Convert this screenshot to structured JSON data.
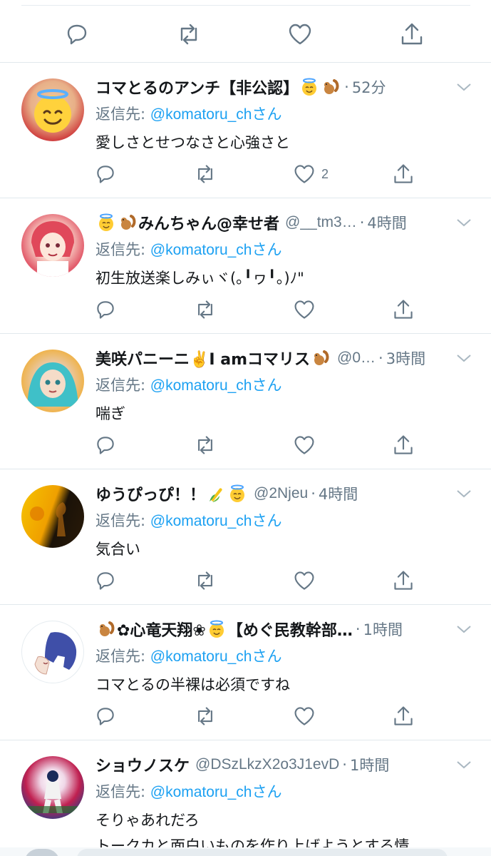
{
  "icons": {
    "reply": "reply-icon",
    "retweet": "retweet-icon",
    "like": "heart-icon",
    "share": "share-icon",
    "caret": "chevron-down-icon"
  },
  "colors": {
    "link": "#1da1f2",
    "muted": "#657786",
    "text": "#14171a",
    "divider": "#e1e8ed"
  },
  "tweets": [
    {
      "name_pre": "",
      "name_main": "コマとるのアンチ【非公認】",
      "name_emojis": [
        "halo-face-emoji",
        "chipmunk-emoji"
      ],
      "handle": "",
      "time": "52分",
      "reply_label": "返信先:",
      "reply_user": "@komatoru_chさん",
      "text": "愛しさとせつなさと心強さと",
      "text2": "",
      "like_count": "2"
    },
    {
      "name_pre_emojis": [
        "halo-face-emoji",
        "chipmunk-emoji"
      ],
      "name_main": "みんちゃん@幸せ者",
      "handle": "@__tm3…",
      "time": "4時間",
      "reply_label": "返信先:",
      "reply_user": "@komatoru_chさん",
      "text": "初生放送楽しみぃヾ(｡╹ヮ╹｡)ﾉ\"",
      "text2": "",
      "like_count": ""
    },
    {
      "name_main": "美咲パニーニ✌️I amコマリス",
      "name_emojis": [
        "chipmunk-emoji"
      ],
      "handle": "@0…",
      "time": "3時間",
      "reply_label": "返信先:",
      "reply_user": "@komatoru_chさん",
      "text": "喘ぎ",
      "text2": "",
      "like_count": ""
    },
    {
      "name_main": "ゆうぴっぴ！！",
      "name_emojis": [
        "corn-emoji",
        "halo-face-emoji"
      ],
      "handle": "@2Njeu",
      "time": "4時間",
      "reply_label": "返信先:",
      "reply_user": "@komatoru_chさん",
      "text": "気合い",
      "text2": "",
      "like_count": ""
    },
    {
      "name_pre_emojis": [
        "chipmunk-emoji"
      ],
      "name_main": "✿心竜天翔❀",
      "name_emojis": [
        "halo-face-emoji"
      ],
      "name_post": "【めぐ民教幹部…",
      "handle": "",
      "time": "1時間",
      "reply_label": "返信先:",
      "reply_user": "@komatoru_chさん",
      "text": "コマとるの半裸は必須ですね",
      "text2": "",
      "like_count": ""
    },
    {
      "name_main": "ショウノスケ",
      "handle": "@DSzLkzX2o3J1evD",
      "time": "1時間",
      "reply_label": "返信先:",
      "reply_user": "@komatoru_chさん",
      "text": "そりゃあれだろ",
      "text2": "トークカと面白いものを作り上げようとする情",
      "like_count": ""
    }
  ]
}
